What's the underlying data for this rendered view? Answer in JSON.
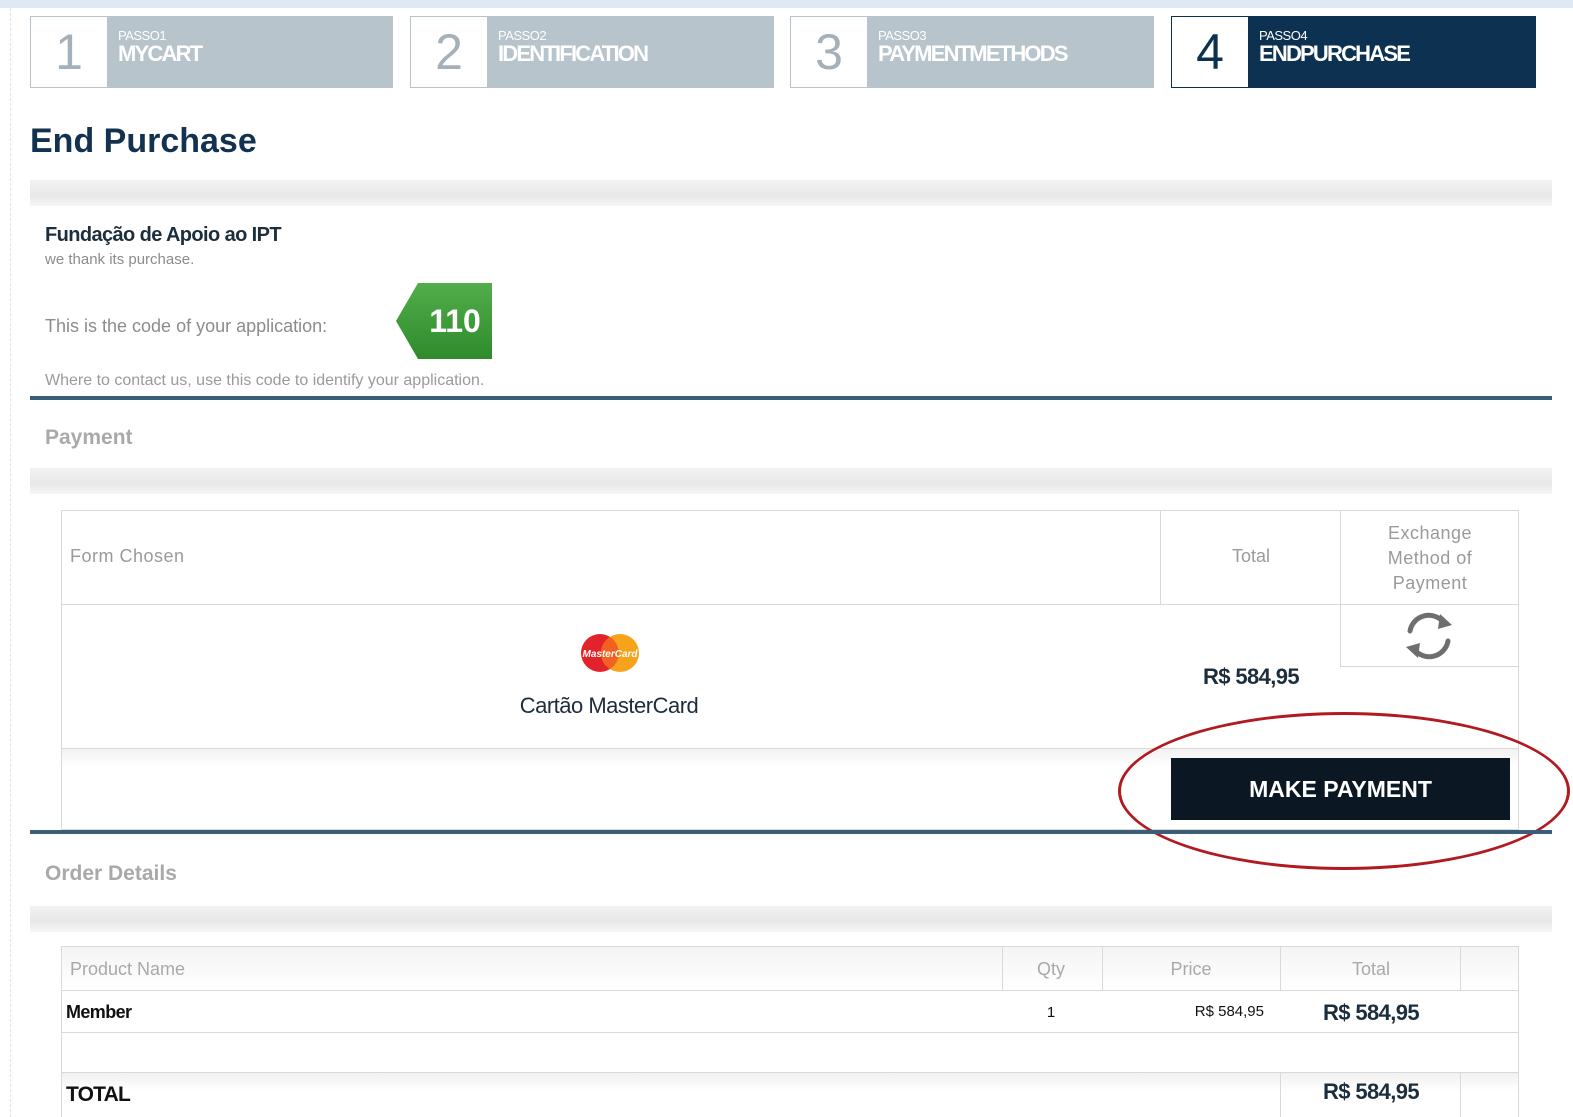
{
  "steps": [
    {
      "number": "1",
      "small": "PASSO1",
      "label": "MYCART",
      "active": false
    },
    {
      "number": "2",
      "small": "PASSO2",
      "label": "IDENTIFICATION",
      "active": false
    },
    {
      "number": "3",
      "small": "PASSO3",
      "label": "PAYMENTMETHODS",
      "active": false
    },
    {
      "number": "4",
      "small": "PASSO4",
      "label": "ENDPURCHASE",
      "active": true
    }
  ],
  "page_title": "End Purchase",
  "confirmation": {
    "org_name": "Fundação de Apoio ao IPT",
    "thanks": "we thank its purchase.",
    "code_label": "This is the code of your application:",
    "code": "110",
    "contact_note": "Where to contact us, use this code to identify your application."
  },
  "payment": {
    "section_title": "Payment",
    "col_form": "Form Chosen",
    "col_total": "Total",
    "col_exchange": [
      "Exchange",
      "Method of",
      "Payment"
    ],
    "card_logo_text": "MasterCard",
    "card_name": "Cartão MasterCard",
    "total": "R$ 584,95",
    "make_payment_label": "MAKE PAYMENT",
    "icons": {
      "exchange": "refresh-icon"
    }
  },
  "order": {
    "section_title": "Order Details",
    "columns": {
      "product": "Product Name",
      "qty": "Qty",
      "price": "Price",
      "total": "Total"
    },
    "rows": [
      {
        "product": "Member",
        "qty": "1",
        "price": "R$ 584,95",
        "total": "R$ 584,95"
      }
    ],
    "total_label": "TOTAL",
    "grand_total": "R$ 584,95"
  },
  "colors": {
    "step_inactive": "#b7c4cc",
    "step_active": "#0d3150",
    "code_badge": "#3f9a3a",
    "button": "#0b1823",
    "highlight_ring": "#b01a20"
  }
}
